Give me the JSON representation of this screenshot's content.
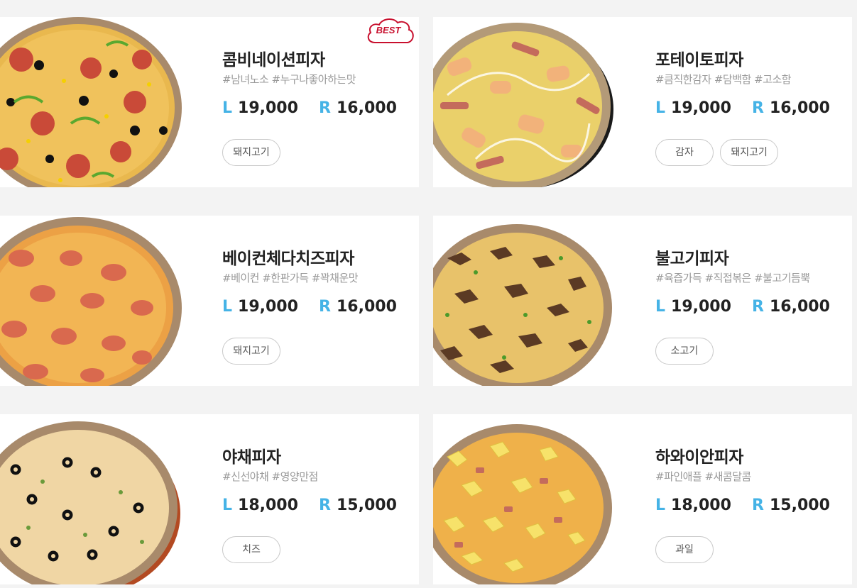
{
  "accent_color": "#45b3e6",
  "best_badge_color": "#c8102e",
  "products": [
    {
      "name": "콤비네이션피자",
      "tags": "#남녀노소 #누구나좋아하는맛",
      "size_l_label": "L",
      "price_l": "19,000",
      "size_r_label": "R",
      "price_r": "16,000",
      "ingredients": [
        "돼지고기"
      ],
      "badge": "BEST",
      "image": "combination-pizza-image"
    },
    {
      "name": "포테이토피자",
      "tags": "#큼직한감자 #담백함 #고소함",
      "size_l_label": "L",
      "price_l": "19,000",
      "size_r_label": "R",
      "price_r": "16,000",
      "ingredients": [
        "감자",
        "돼지고기"
      ],
      "image": "potato-pizza-image"
    },
    {
      "name": "베이컨체다치즈피자",
      "tags": "#베이컨 #한판가득 #꽉채운맛",
      "size_l_label": "L",
      "price_l": "19,000",
      "size_r_label": "R",
      "price_r": "16,000",
      "ingredients": [
        "돼지고기"
      ],
      "image": "bacon-cheddar-pizza-image"
    },
    {
      "name": "불고기피자",
      "tags": "#육즙가득 #직접볶은 #불고기듬뿍",
      "size_l_label": "L",
      "price_l": "19,000",
      "size_r_label": "R",
      "price_r": "16,000",
      "ingredients": [
        "소고기"
      ],
      "image": "bulgogi-pizza-image"
    },
    {
      "name": "야채피자",
      "tags": "#신선야채 #영양만점",
      "size_l_label": "L",
      "price_l": "18,000",
      "size_r_label": "R",
      "price_r": "15,000",
      "ingredients": [
        "치즈"
      ],
      "image": "vegetable-pizza-image"
    },
    {
      "name": "하와이안피자",
      "tags": "#파인애플 #새콤달콤",
      "size_l_label": "L",
      "price_l": "18,000",
      "size_r_label": "R",
      "price_r": "15,000",
      "ingredients": [
        "과일"
      ],
      "image": "hawaiian-pizza-image"
    }
  ]
}
